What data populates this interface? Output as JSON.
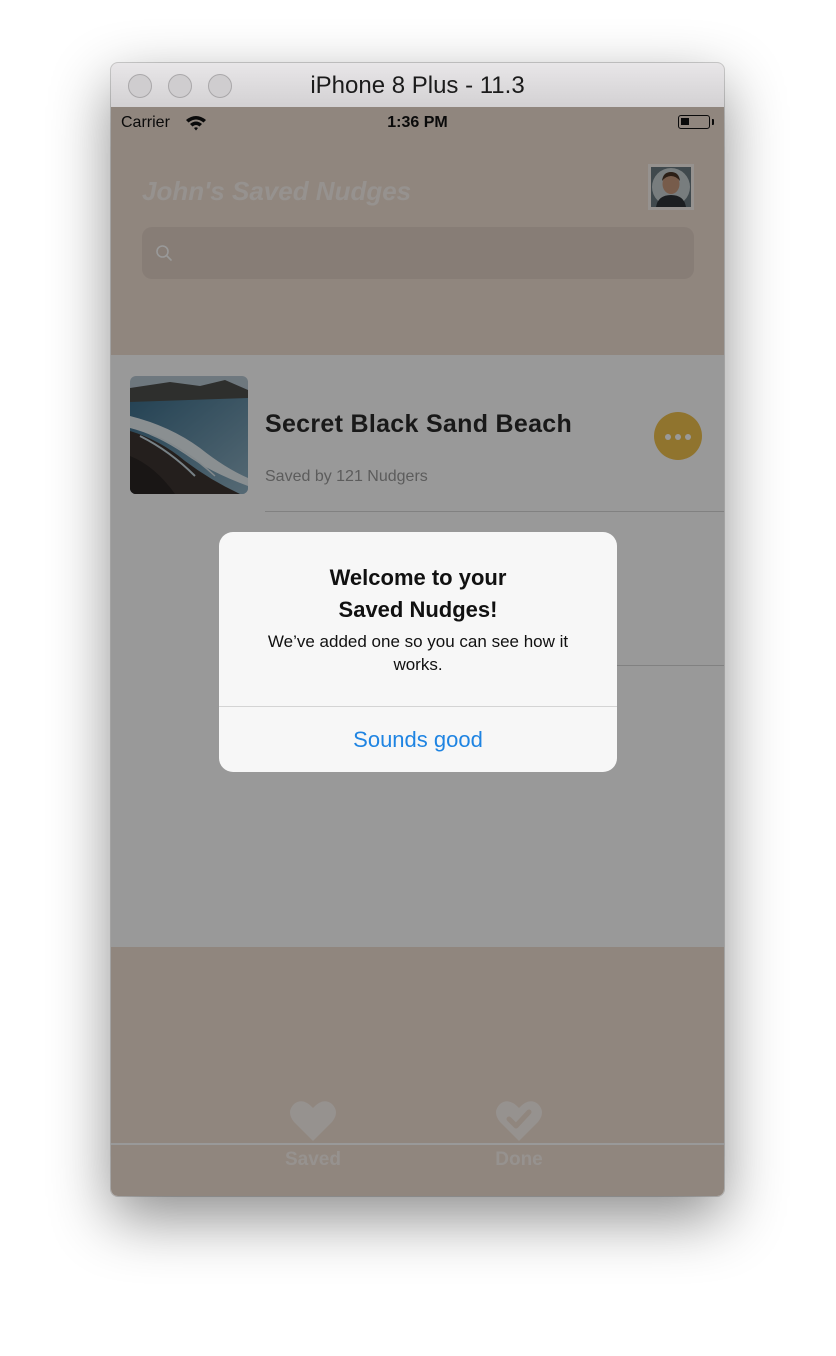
{
  "window": {
    "title": "iPhone 8 Plus - 11.3"
  },
  "status_bar": {
    "carrier": "Carrier",
    "time": "1:36 PM"
  },
  "header": {
    "title": "John's Saved Nudges",
    "search_placeholder": ""
  },
  "list": {
    "items": [
      {
        "title": "Secret Black Sand Beach",
        "subtitle": "Saved by 121 Nudgers"
      }
    ]
  },
  "tabs": [
    {
      "label": "Saved",
      "icon": "heart-icon"
    },
    {
      "label": "Done",
      "icon": "heart-check-icon"
    }
  ],
  "alert": {
    "title_line1": "Welcome to your",
    "title_line2": "Saved Nudges!",
    "message": "We’ve added one so you can see how it works.",
    "button": "Sounds good"
  },
  "colors": {
    "header_bg": "#f0dfd2",
    "accent": "#f1c14e",
    "alert_button": "#1f84e2"
  }
}
